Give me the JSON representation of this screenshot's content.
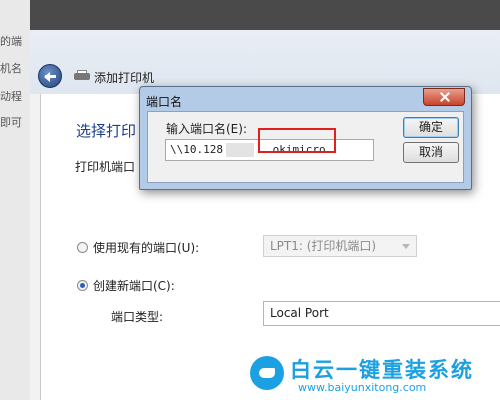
{
  "background_fragments": [
    "的端",
    "机名",
    "动程",
    "即可"
  ],
  "wizard": {
    "title": "添加打印机",
    "section_title": "选择打印",
    "port_prompt": "打印机端口",
    "use_existing_label": "使用现有的端口(U):",
    "use_existing_value": "LPT1: (打印机端口)",
    "create_new_label": "创建新端口(C):",
    "port_type_label": "端口类型:",
    "port_type_value": "Local Port"
  },
  "dialog": {
    "title": "端口名",
    "prompt": "输入端口名(E):",
    "input_visible_start": "\\\\10.128",
    "input_visible_end": ".okimicro",
    "ok_label": "确定",
    "cancel_label": "取消"
  },
  "watermark": {
    "name": "白云一键重装系统",
    "url": "www.baiyunxitong.com"
  },
  "colors": {
    "section_title": "#1e3f8a",
    "highlight_box": "#e01f1f",
    "dialog_frame": "#b3cbe6",
    "watermark": "#1ba1e2"
  }
}
